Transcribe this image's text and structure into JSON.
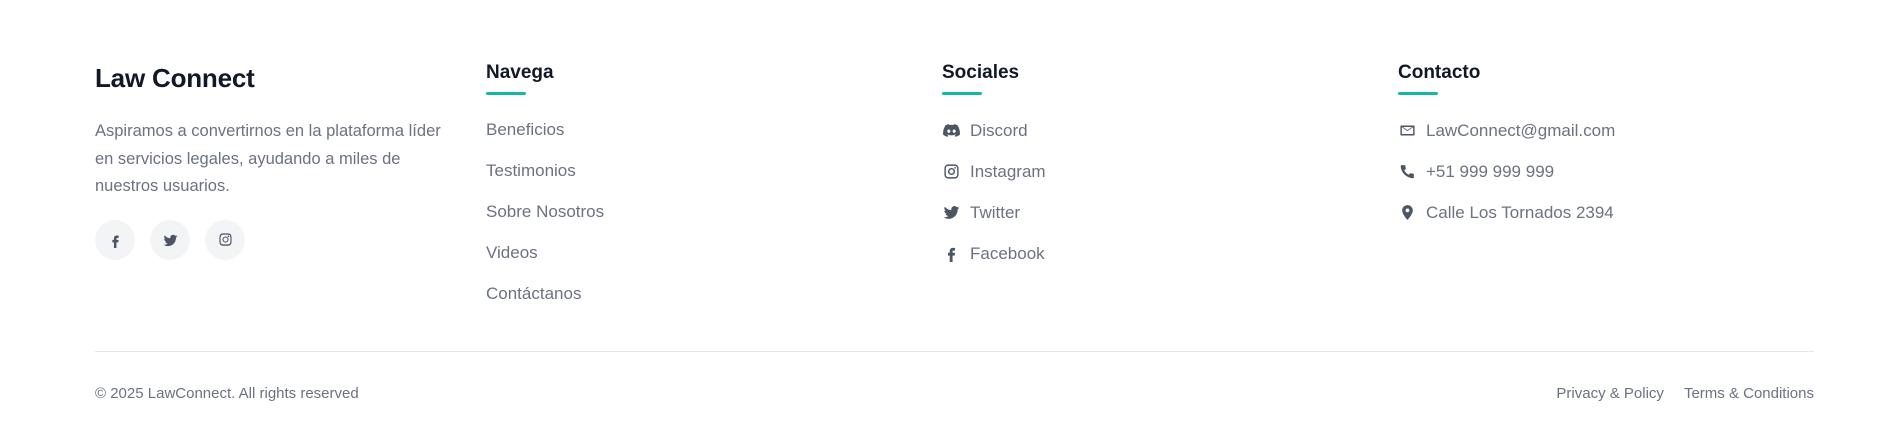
{
  "brand": {
    "title": "Law Connect",
    "description": "Aspiramos a convertirnos en la plataforma líder en servicios legales, ayudando a miles de nuestros usuarios.",
    "social_icons": [
      "facebook-icon",
      "twitter-icon",
      "instagram-icon"
    ]
  },
  "nav": {
    "heading": "Navega",
    "items": [
      {
        "label": "Beneficios"
      },
      {
        "label": "Testimonios"
      },
      {
        "label": "Sobre Nosotros"
      },
      {
        "label": "Videos"
      },
      {
        "label": "Contáctanos"
      }
    ]
  },
  "social": {
    "heading": "Sociales",
    "items": [
      {
        "label": "Discord",
        "icon": "discord-icon"
      },
      {
        "label": "Instagram",
        "icon": "instagram-icon"
      },
      {
        "label": "Twitter",
        "icon": "twitter-icon"
      },
      {
        "label": "Facebook",
        "icon": "facebook-icon"
      }
    ]
  },
  "contact": {
    "heading": "Contacto",
    "items": [
      {
        "label": "LawConnect@gmail.com",
        "icon": "envelope-icon"
      },
      {
        "label": "+51 999 999 999",
        "icon": "phone-icon"
      },
      {
        "label": "Calle Los Tornados 2394",
        "icon": "map-pin-icon"
      }
    ]
  },
  "bottom": {
    "copyright": "© 2025 LawConnect. All rights reserved",
    "privacy": "Privacy & Policy",
    "terms": "Terms & Conditions"
  },
  "colors": {
    "accent": "#14b8a6",
    "heading": "#111827",
    "text": "#6b7280",
    "circle_bg": "#f3f4f6"
  }
}
